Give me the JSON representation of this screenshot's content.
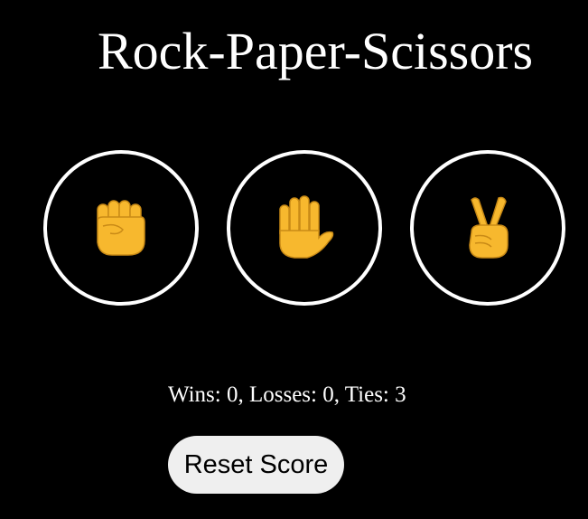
{
  "game": {
    "title": "Rock-Paper-Scissors",
    "moves": [
      {
        "name": "rock",
        "icon": "raised-fist-icon"
      },
      {
        "name": "paper",
        "icon": "raised-hand-icon"
      },
      {
        "name": "scissors",
        "icon": "victory-hand-icon"
      }
    ],
    "score_text": "Wins: 0, Losses: 0, Ties: 3",
    "reset_label": "Reset Score"
  },
  "colors": {
    "background": "#000000",
    "text": "#ffffff",
    "button_border": "#ffffff",
    "emoji_yellow": "#f7b82e",
    "reset_bg": "#efefef"
  }
}
